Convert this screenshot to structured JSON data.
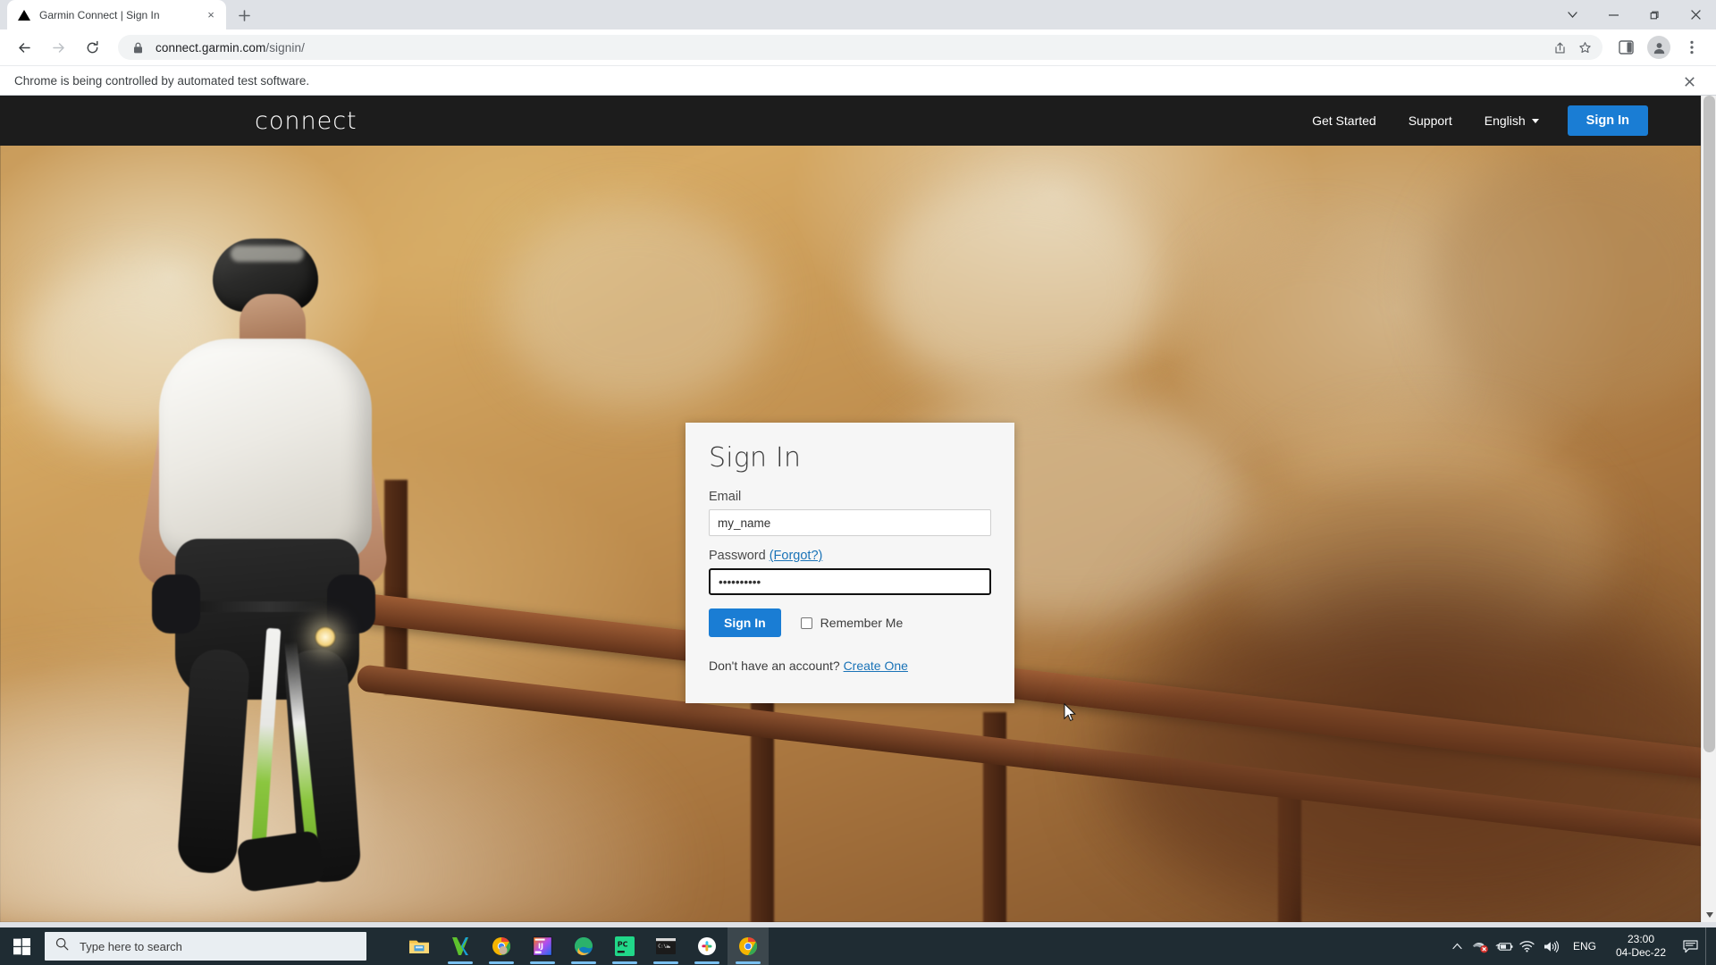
{
  "browser": {
    "tab": {
      "title": "Garmin Connect | Sign In",
      "favicon_name": "garmin-triangle-icon",
      "close_label": "×"
    },
    "new_tab_label": "+",
    "window_controls": {
      "tab_search_label": "∨",
      "minimize_label": "—",
      "maximize_label": "❑",
      "close_label": "✕"
    },
    "toolbar": {
      "back_label": "←",
      "forward_label": "→",
      "reload_label": "⟳",
      "lock_icon_name": "lock-icon",
      "url_host": "connect.garmin.com",
      "url_path": "/signin/",
      "share_icon_name": "share-icon",
      "bookmark_icon_name": "star-icon",
      "sidepanel_icon_name": "side-panel-icon",
      "profile_icon_name": "profile-avatar-icon",
      "menu_icon_name": "three-dot-menu-icon"
    },
    "infobar": {
      "message": "Chrome is being controlled by automated test software.",
      "close_label": "✕"
    },
    "scrollbar": {
      "visible": true
    }
  },
  "page": {
    "nav": {
      "logo_text": "connect",
      "links": [
        {
          "label": "Get Started",
          "name": "get-started"
        },
        {
          "label": "Support",
          "name": "support"
        }
      ],
      "language": "English",
      "sign_in_label": "Sign In"
    },
    "signin_card": {
      "title": "Sign In",
      "email_label": "Email",
      "email_value": "my_name",
      "email_placeholder": "",
      "password_label": "Password",
      "forgot_label": "(Forgot?)",
      "password_value": "••••••••••",
      "password_placeholder": "",
      "submit_label": "Sign In",
      "remember_label": "Remember Me",
      "remember_checked": false,
      "no_account_text": "Don't have an account?",
      "create_one_label": "Create One"
    },
    "colors": {
      "accent_blue": "#1a7dd4",
      "nav_dark": "#1c1c1c",
      "link_blue": "#1a73b7",
      "card_bg": "#f6f6f6"
    }
  },
  "taskbar": {
    "start_label": "start-button",
    "search_placeholder": "Type here to search",
    "apps": [
      {
        "name": "file-explorer-icon",
        "label": "File Explorer"
      },
      {
        "name": "kaspersky-icon",
        "label": "Kaspersky"
      },
      {
        "name": "chrome-profile-icon",
        "label": "Google Chrome"
      },
      {
        "name": "intellij-idea-icon",
        "label": "IntelliJ IDEA"
      },
      {
        "name": "microsoft-edge-icon",
        "label": "Microsoft Edge"
      },
      {
        "name": "pycharm-icon",
        "label": "PyCharm"
      },
      {
        "name": "terminal-icon",
        "label": "Command Prompt"
      },
      {
        "name": "slack-icon",
        "label": "Slack"
      },
      {
        "name": "chrome-icon",
        "label": "Google Chrome"
      }
    ],
    "tray": {
      "show_hidden_label": "⌃",
      "icons": [
        {
          "name": "kaspersky-tray-icon"
        },
        {
          "name": "battery-icon"
        },
        {
          "name": "wifi-icon"
        },
        {
          "name": "volume-icon"
        }
      ],
      "language": "ENG",
      "time": "23:00",
      "date": "04-Dec-22",
      "action_center_name": "action-center-icon"
    }
  }
}
